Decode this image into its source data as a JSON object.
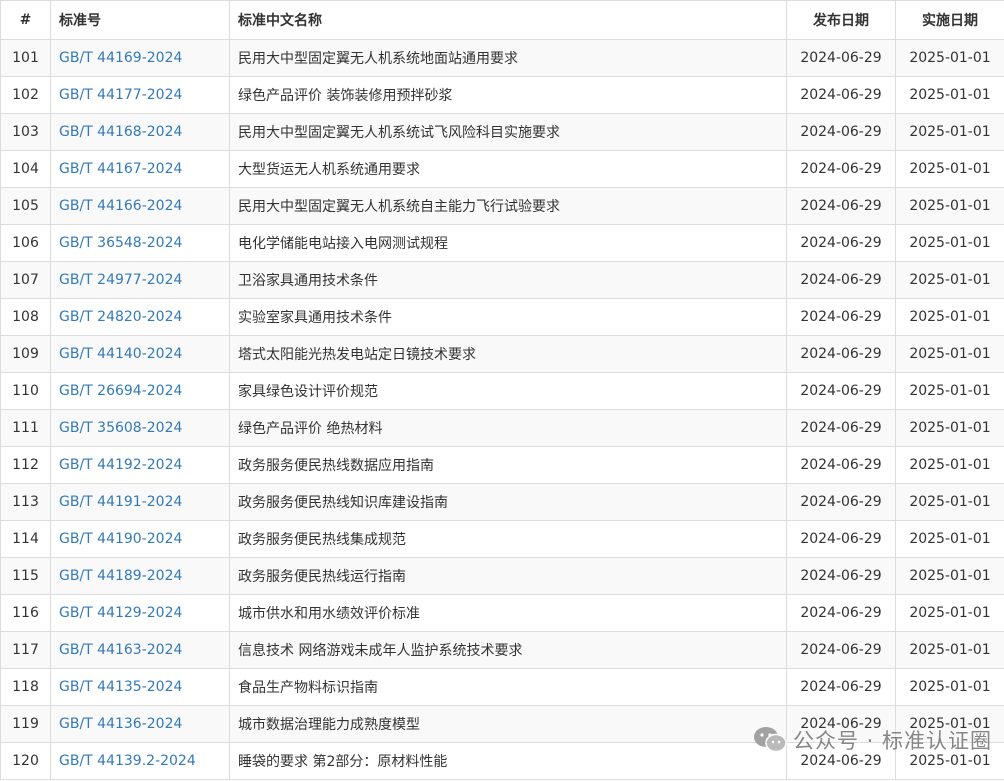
{
  "table": {
    "headers": {
      "idx": "#",
      "code": "标准号",
      "name": "标准中文名称",
      "publish": "发布日期",
      "effective": "实施日期"
    },
    "rows": [
      {
        "idx": "101",
        "code": "GB/T 44169-2024",
        "name": "民用大中型固定翼无人机系统地面站通用要求",
        "publish": "2024-06-29",
        "effective": "2025-01-01"
      },
      {
        "idx": "102",
        "code": "GB/T 44177-2024",
        "name": "绿色产品评价 装饰装修用预拌砂浆",
        "publish": "2024-06-29",
        "effective": "2025-01-01"
      },
      {
        "idx": "103",
        "code": "GB/T 44168-2024",
        "name": "民用大中型固定翼无人机系统试飞风险科目实施要求",
        "publish": "2024-06-29",
        "effective": "2025-01-01"
      },
      {
        "idx": "104",
        "code": "GB/T 44167-2024",
        "name": "大型货运无人机系统通用要求",
        "publish": "2024-06-29",
        "effective": "2025-01-01"
      },
      {
        "idx": "105",
        "code": "GB/T 44166-2024",
        "name": "民用大中型固定翼无人机系统自主能力飞行试验要求",
        "publish": "2024-06-29",
        "effective": "2025-01-01"
      },
      {
        "idx": "106",
        "code": "GB/T 36548-2024",
        "name": "电化学储能电站接入电网测试规程",
        "publish": "2024-06-29",
        "effective": "2025-01-01"
      },
      {
        "idx": "107",
        "code": "GB/T 24977-2024",
        "name": "卫浴家具通用技术条件",
        "publish": "2024-06-29",
        "effective": "2025-01-01"
      },
      {
        "idx": "108",
        "code": "GB/T 24820-2024",
        "name": "实验室家具通用技术条件",
        "publish": "2024-06-29",
        "effective": "2025-01-01"
      },
      {
        "idx": "109",
        "code": "GB/T 44140-2024",
        "name": "塔式太阳能光热发电站定日镜技术要求",
        "publish": "2024-06-29",
        "effective": "2025-01-01"
      },
      {
        "idx": "110",
        "code": "GB/T 26694-2024",
        "name": "家具绿色设计评价规范",
        "publish": "2024-06-29",
        "effective": "2025-01-01"
      },
      {
        "idx": "111",
        "code": "GB/T 35608-2024",
        "name": "绿色产品评价 绝热材料",
        "publish": "2024-06-29",
        "effective": "2025-01-01"
      },
      {
        "idx": "112",
        "code": "GB/T 44192-2024",
        "name": "政务服务便民热线数据应用指南",
        "publish": "2024-06-29",
        "effective": "2025-01-01"
      },
      {
        "idx": "113",
        "code": "GB/T 44191-2024",
        "name": "政务服务便民热线知识库建设指南",
        "publish": "2024-06-29",
        "effective": "2025-01-01"
      },
      {
        "idx": "114",
        "code": "GB/T 44190-2024",
        "name": "政务服务便民热线集成规范",
        "publish": "2024-06-29",
        "effective": "2025-01-01"
      },
      {
        "idx": "115",
        "code": "GB/T 44189-2024",
        "name": "政务服务便民热线运行指南",
        "publish": "2024-06-29",
        "effective": "2025-01-01"
      },
      {
        "idx": "116",
        "code": "GB/T 44129-2024",
        "name": "城市供水和用水绩效评价标准",
        "publish": "2024-06-29",
        "effective": "2025-01-01"
      },
      {
        "idx": "117",
        "code": "GB/T 44163-2024",
        "name": "信息技术 网络游戏未成年人监护系统技术要求",
        "publish": "2024-06-29",
        "effective": "2025-01-01"
      },
      {
        "idx": "118",
        "code": "GB/T 44135-2024",
        "name": "食品生产物料标识指南",
        "publish": "2024-06-29",
        "effective": "2025-01-01"
      },
      {
        "idx": "119",
        "code": "GB/T 44136-2024",
        "name": "城市数据治理能力成熟度模型",
        "publish": "2024-06-29",
        "effective": "2025-01-01"
      },
      {
        "idx": "120",
        "code": "GB/T 44139.2-2024",
        "name": "睡袋的要求 第2部分：原材料性能",
        "publish": "2024-06-29",
        "effective": "2025-01-01"
      }
    ]
  },
  "watermark": {
    "icon": "wechat-icon",
    "text": "公众号 · 标准认证圈"
  },
  "colors": {
    "link": "#337ab7",
    "border": "#dddddd",
    "stripe": "#f9f9f9"
  }
}
